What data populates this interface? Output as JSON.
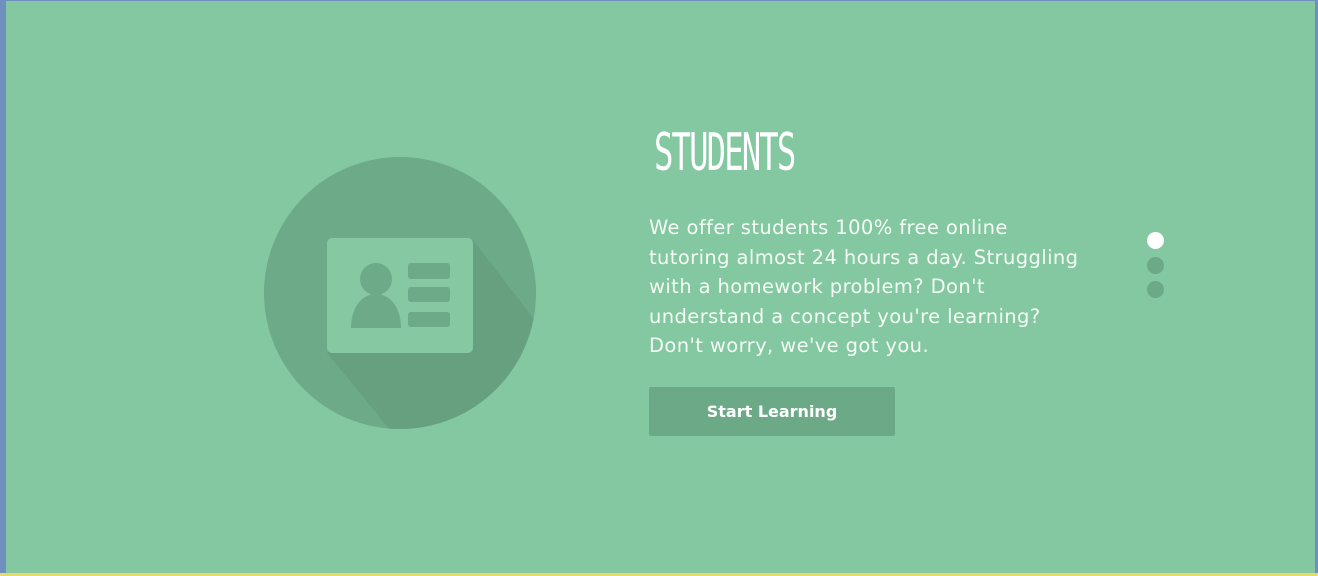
{
  "hero": {
    "title": "STUDENTS",
    "description": "We offer students 100% free online tutoring almost 24 hours a day. Struggling with a homework problem? Don't understand a concept you're learning? Don't worry, we've got you.",
    "cta_label": "Start Learning",
    "icon": "id-card-icon"
  },
  "pager": {
    "total": 3,
    "active_index": 0
  },
  "colors": {
    "panel_bg": "#84c8a1",
    "circle": "#6dab88",
    "shadow": "#67a07f",
    "card": "#85c8a1",
    "button": "#6ca987",
    "text": "#ffffff",
    "frame": "#6f8fbf",
    "bottom_edge": "#e7d96a"
  }
}
